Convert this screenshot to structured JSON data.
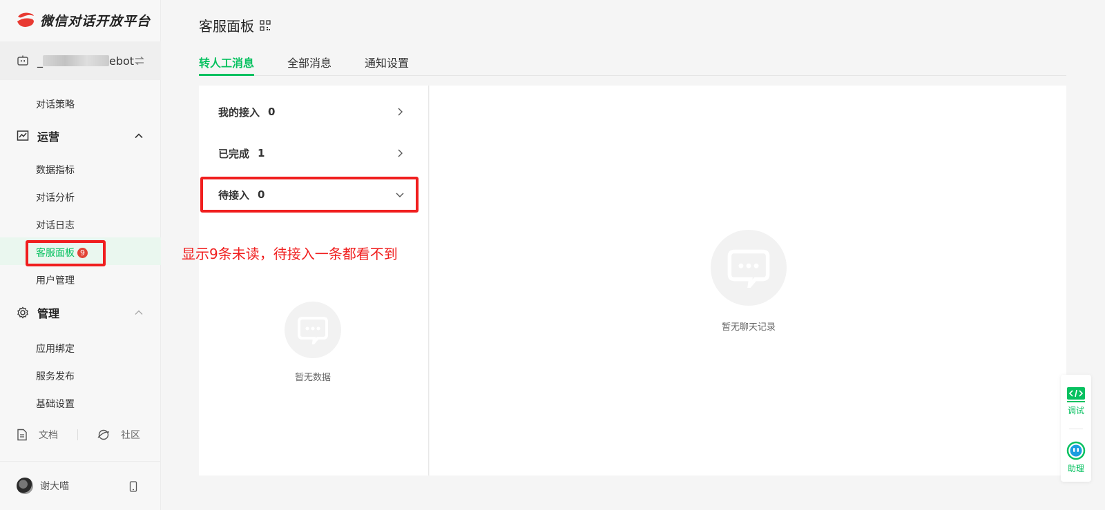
{
  "app": {
    "name": "微信对话开放平台"
  },
  "bot": {
    "name_suffix": "ebot",
    "name_prefix": "_"
  },
  "sidebar": {
    "partial_item": "对话策略",
    "sections": [
      {
        "label": "运营",
        "items": [
          "数据指标",
          "对话分析",
          "对话日志",
          "客服面板",
          "用户管理"
        ]
      },
      {
        "label": "管理",
        "items": [
          "应用绑定",
          "服务发布",
          "基础设置"
        ]
      }
    ],
    "active_badge": "9",
    "links": {
      "docs": "文档",
      "community": "社区"
    },
    "user": {
      "name": "谢大喵"
    }
  },
  "page": {
    "title": "客服面板"
  },
  "tabs": [
    "转人工消息",
    "全部消息",
    "通知设置"
  ],
  "queue": [
    {
      "label": "我的接入",
      "count": "0"
    },
    {
      "label": "已完成",
      "count": "1"
    },
    {
      "label": "待接入",
      "count": "0"
    }
  ],
  "left_empty_text": "暂无数据",
  "right_empty_text": "暂无聊天记录",
  "annotation": "显示9条未读，待接入一条都看不到",
  "float_tools": {
    "debug": "调试",
    "assistant": "助理"
  },
  "colors": {
    "accent": "#07c160",
    "annotation": "#f01e1e",
    "badge": "#e24436"
  }
}
